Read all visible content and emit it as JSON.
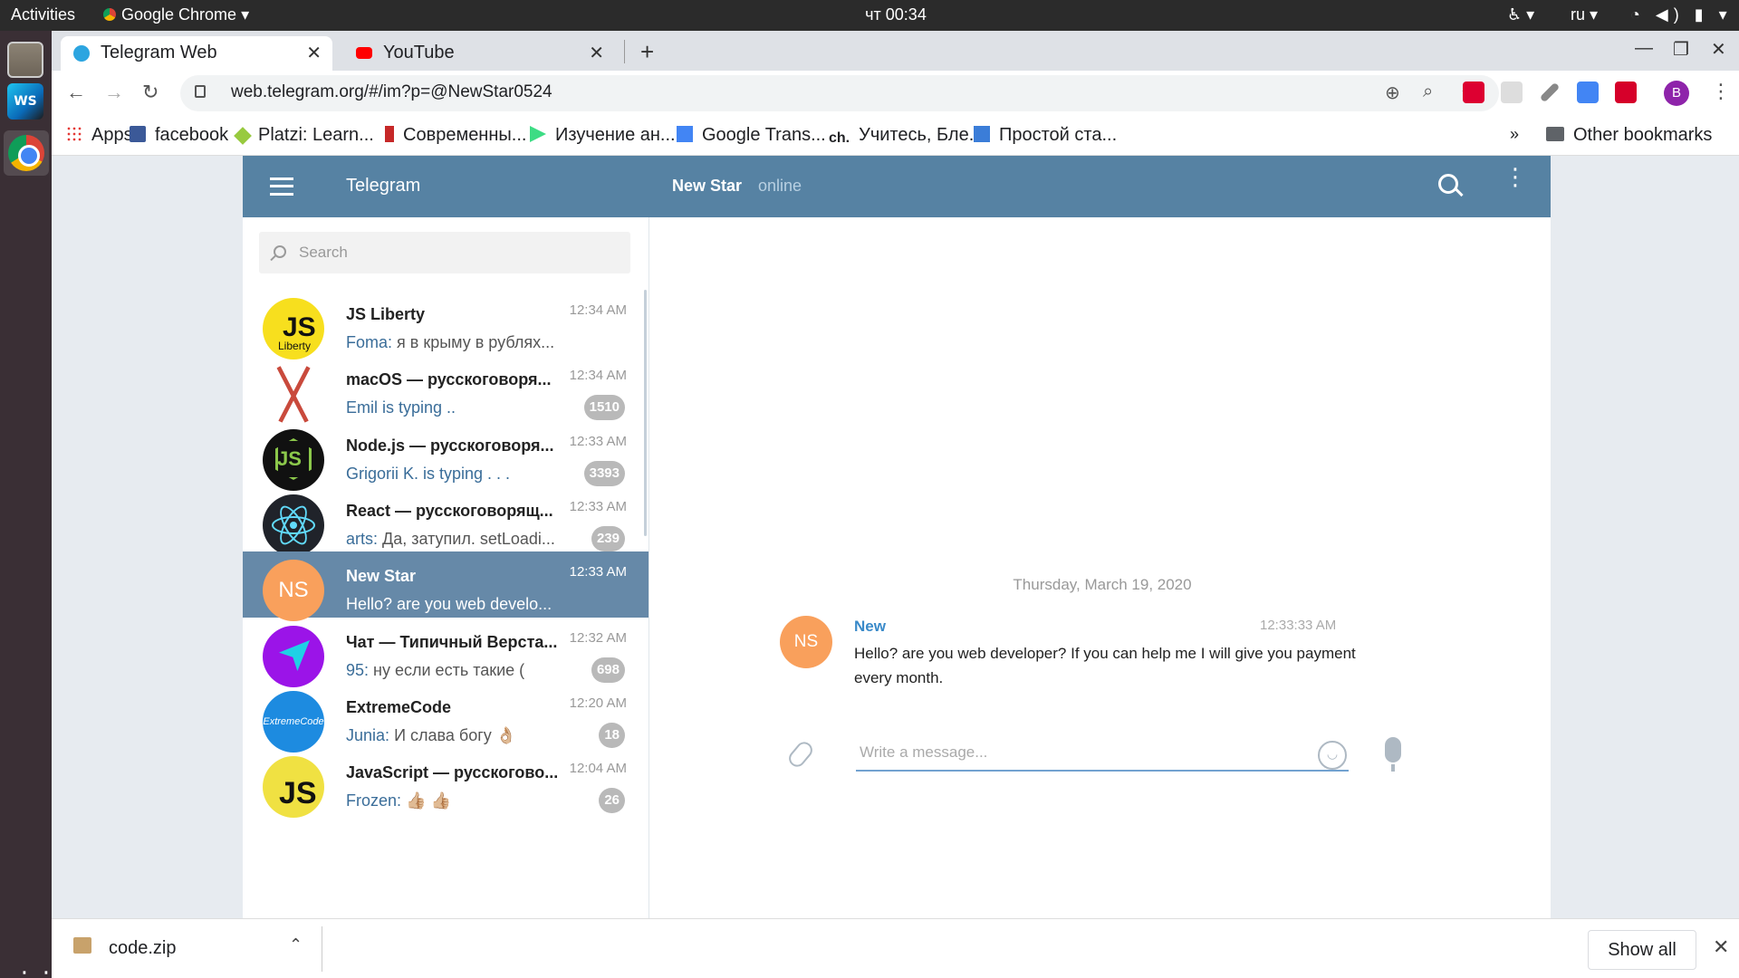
{
  "system": {
    "activities": "Activities",
    "app_name": "Google Chrome",
    "clock": "чт 00:34",
    "lang": "ru"
  },
  "browser": {
    "tabs": [
      {
        "title": "Telegram Web",
        "icon": "telegram-icon",
        "active": true
      },
      {
        "title": "YouTube",
        "icon": "youtube-icon",
        "active": false
      }
    ],
    "url": "web.telegram.org/#/im?p=@NewStar0524",
    "profile_initial": "B",
    "bookmarks": [
      {
        "label": "Apps"
      },
      {
        "label": "facebook"
      },
      {
        "label": "Platzi: Learn..."
      },
      {
        "label": "Современны..."
      },
      {
        "label": "Изучение ан..."
      },
      {
        "label": "Google Trans..."
      },
      {
        "label": "Учитесь, Бле...",
        "prefix": "ch."
      },
      {
        "label": "Простой ста..."
      }
    ],
    "other_bookmarks": "Other bookmarks"
  },
  "telegram": {
    "brand": "Telegram",
    "peer": {
      "name": "New Star",
      "status": "online"
    },
    "search_placeholder": "Search",
    "chats": [
      {
        "name": "JS Liberty",
        "time": "12:34 AM",
        "sender": "Foma:",
        "text": "я в крыму в рублях...",
        "badge": ""
      },
      {
        "name": "macOS — русскоговоря...",
        "time": "12:34 AM",
        "sender": "",
        "text": "Emil is typing ..",
        "badge": "1510"
      },
      {
        "name": "Node.js — русскоговоря...",
        "time": "12:33 AM",
        "sender": "",
        "text": "Grigorii K. is typing . . .",
        "badge": "3393"
      },
      {
        "name": "React — русскоговорящ...",
        "time": "12:33 AM",
        "sender": "arts:",
        "text": "Да, затупил. setLoadi...",
        "badge": "239"
      },
      {
        "name": "New Star",
        "time": "12:33 AM",
        "sender": "",
        "text": "Hello? are you web develo...",
        "badge": "",
        "active": true,
        "initials": "NS"
      },
      {
        "name": "Чат — Типичный Верста...",
        "time": "12:32 AM",
        "sender": "95:",
        "text": "ну если есть такие (",
        "badge": "698"
      },
      {
        "name": "ExtremeCode",
        "time": "12:20 AM",
        "sender": "Junia:",
        "text": "И слава богу 👌🏼",
        "badge": "18"
      },
      {
        "name": "JavaScript — русскогово...",
        "time": "12:04 AM",
        "sender": "Frozen:",
        "text": "👍🏼 👍🏼",
        "badge": "26"
      }
    ],
    "avatar_text": {
      "js_liberty_main": "JS",
      "js_liberty_sub": "Liberty",
      "node": "JS",
      "extremecode": "ExtremeCode",
      "javascript": "JS"
    },
    "conversation": {
      "date": "Thursday, March 19, 2020",
      "message": {
        "author": "New",
        "initials": "NS",
        "time": "12:33:33 AM",
        "text": "Hello? are you web developer? If you can help me I will give you payment every month."
      },
      "composer_placeholder": "Write a message..."
    }
  },
  "downloads": {
    "file": "code.zip",
    "show_all": "Show all"
  }
}
